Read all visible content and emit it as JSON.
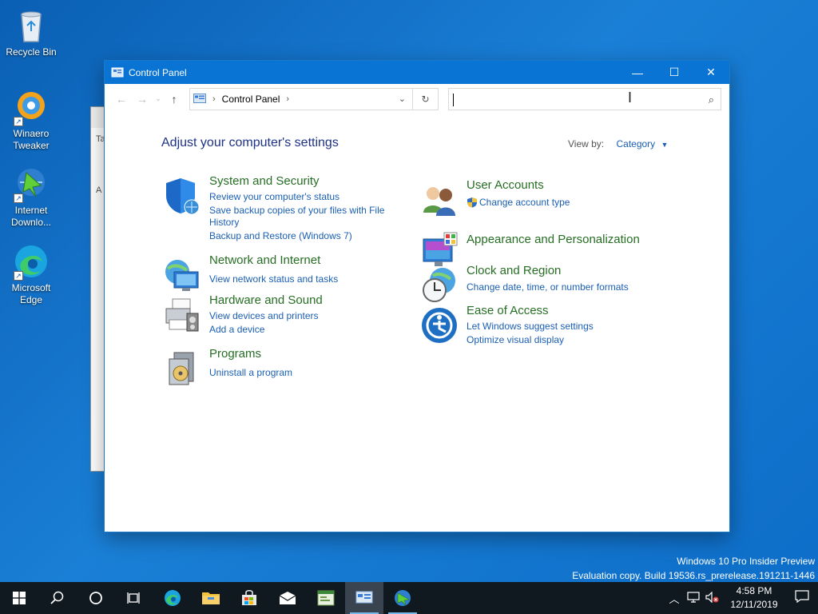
{
  "desktop": {
    "icons": [
      {
        "label": "Recycle Bin"
      },
      {
        "label": "Winaero Tweaker"
      },
      {
        "label": "Internet Downlo..."
      },
      {
        "label": "Microsoft Edge"
      }
    ],
    "background_window": {
      "tab_label": "Ta",
      "letter": "A"
    }
  },
  "window": {
    "title": "Control Panel",
    "controls": {
      "minimize": "—",
      "maximize": "☐",
      "close": "✕"
    },
    "address": {
      "path": "Control Panel"
    },
    "search": {
      "placeholder": ""
    },
    "heading": "Adjust your computer's settings",
    "view_by": {
      "label": "View by:",
      "value": "Category"
    },
    "categories_left": [
      {
        "title": "System and Security",
        "links": [
          "Review your computer's status",
          "Save backup copies of your files with File",
          "History",
          "Backup and Restore (Windows 7)"
        ]
      },
      {
        "title": "Network and Internet",
        "links": [
          "View network status and tasks"
        ]
      },
      {
        "title": "Hardware and Sound",
        "links": [
          "View devices and printers",
          "Add a device"
        ]
      },
      {
        "title": "Programs",
        "links": [
          "Uninstall a program"
        ]
      }
    ],
    "categories_right": [
      {
        "title": "User Accounts",
        "links": [
          "Change account type"
        ]
      },
      {
        "title": "Appearance and Personalization",
        "links": []
      },
      {
        "title": "Clock and Region",
        "links": [
          "Change date, time, or number formats"
        ]
      },
      {
        "title": "Ease of Access",
        "links": [
          "Let Windows suggest settings",
          "Optimize visual display"
        ]
      }
    ]
  },
  "watermark": {
    "line1": "Windows 10 Pro Insider Preview",
    "line2": "Evaluation copy. Build 19536.rs_prerelease.191211-1446"
  },
  "taskbar": {
    "clock_time": "4:58 PM",
    "clock_date": "12/11/2019"
  },
  "colors": {
    "accent": "#0a74d4",
    "category_title": "#266e24",
    "link": "#1a5fb4",
    "heading": "#1e3287",
    "taskbar": "#101820"
  }
}
